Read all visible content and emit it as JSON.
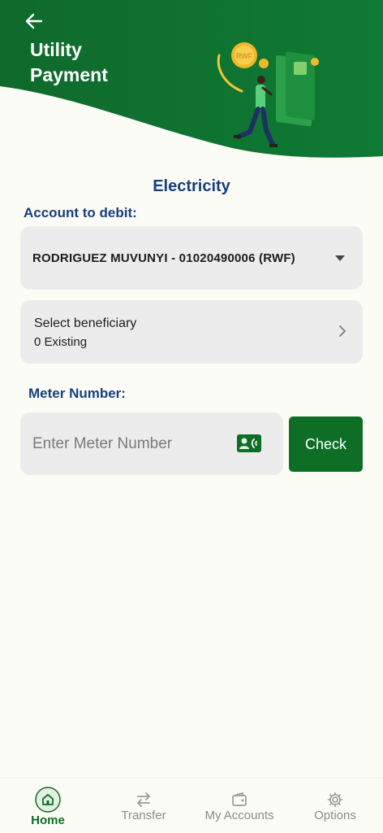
{
  "header": {
    "title_line1": "Utility",
    "title_line2": "Payment",
    "coin_text": "RWF"
  },
  "section_title": "Electricity",
  "account": {
    "label": "Account to debit:",
    "selected": "RODRIGUEZ MUVUNYI - 01020490006 (RWF)"
  },
  "beneficiary": {
    "title": "Select beneficiary",
    "count_text": "0 Existing"
  },
  "meter": {
    "label": "Meter Number:",
    "placeholder": "Enter Meter Number",
    "check_label": "Check"
  },
  "nav": {
    "items": [
      {
        "label": "Home",
        "icon": "home-icon",
        "active": true
      },
      {
        "label": "Transfer",
        "icon": "transfer-icon",
        "active": false
      },
      {
        "label": "My Accounts",
        "icon": "wallet-icon",
        "active": false
      },
      {
        "label": "Options",
        "icon": "gear-icon",
        "active": false
      }
    ]
  },
  "colors": {
    "brand_green": "#0e6e26",
    "heading_blue": "#173f7f",
    "background": "#fbfcf6",
    "card_gray": "#ececec"
  }
}
